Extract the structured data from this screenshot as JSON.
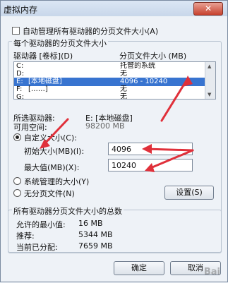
{
  "window": {
    "title": "虚拟内存",
    "close_label": "✕"
  },
  "auto_manage": {
    "label": "自动管理所有驱动器的分页文件大小(A)",
    "checked": false
  },
  "per_drive_group": {
    "title": "每个驱动器的分页文件大小",
    "col_drive": "驱动器 [卷标](D)",
    "col_size": "分页文件大小 (MB)",
    "rows": [
      {
        "drive": "C:",
        "label": "",
        "size": "托管的系统",
        "selected": false
      },
      {
        "drive": "D:",
        "label": "",
        "size": "无",
        "selected": false
      },
      {
        "drive": "E:",
        "label": "[本地磁盘]",
        "size": "4096 - 10240",
        "selected": true
      },
      {
        "drive": "F:",
        "label": "[……]",
        "size": "无",
        "selected": false
      },
      {
        "drive": "G:",
        "label": "",
        "size": "无",
        "selected": false
      }
    ]
  },
  "selected_drive": {
    "label": "所选驱动器:",
    "value": "E:  [本地磁盘]",
    "free_label": "可用空间:",
    "free_value": "98200 MB"
  },
  "custom_size": {
    "label": "自定义大小(C):",
    "initial_label": "初始大小(MB)(I):",
    "initial_value": "4096",
    "max_label": "最大值(MB)(X):",
    "max_value": "10240"
  },
  "system_managed": {
    "label": "系统管理的大小(Y)"
  },
  "no_paging": {
    "label": "无分页文件(N)"
  },
  "set_button": {
    "label": "设置(S)"
  },
  "totals_group": {
    "title": "所有驱动器分页文件大小的总数",
    "min_label": "允许的最小值:",
    "min_value": "16 MB",
    "recommended_label": "推荐:",
    "recommended_value": "5344 MB",
    "current_label": "当前已分配:",
    "current_value": "7659 MB"
  },
  "footer": {
    "ok_label": "确定",
    "cancel_label": "取消"
  },
  "annotation_color": "#e0303a",
  "watermark": "Bai"
}
